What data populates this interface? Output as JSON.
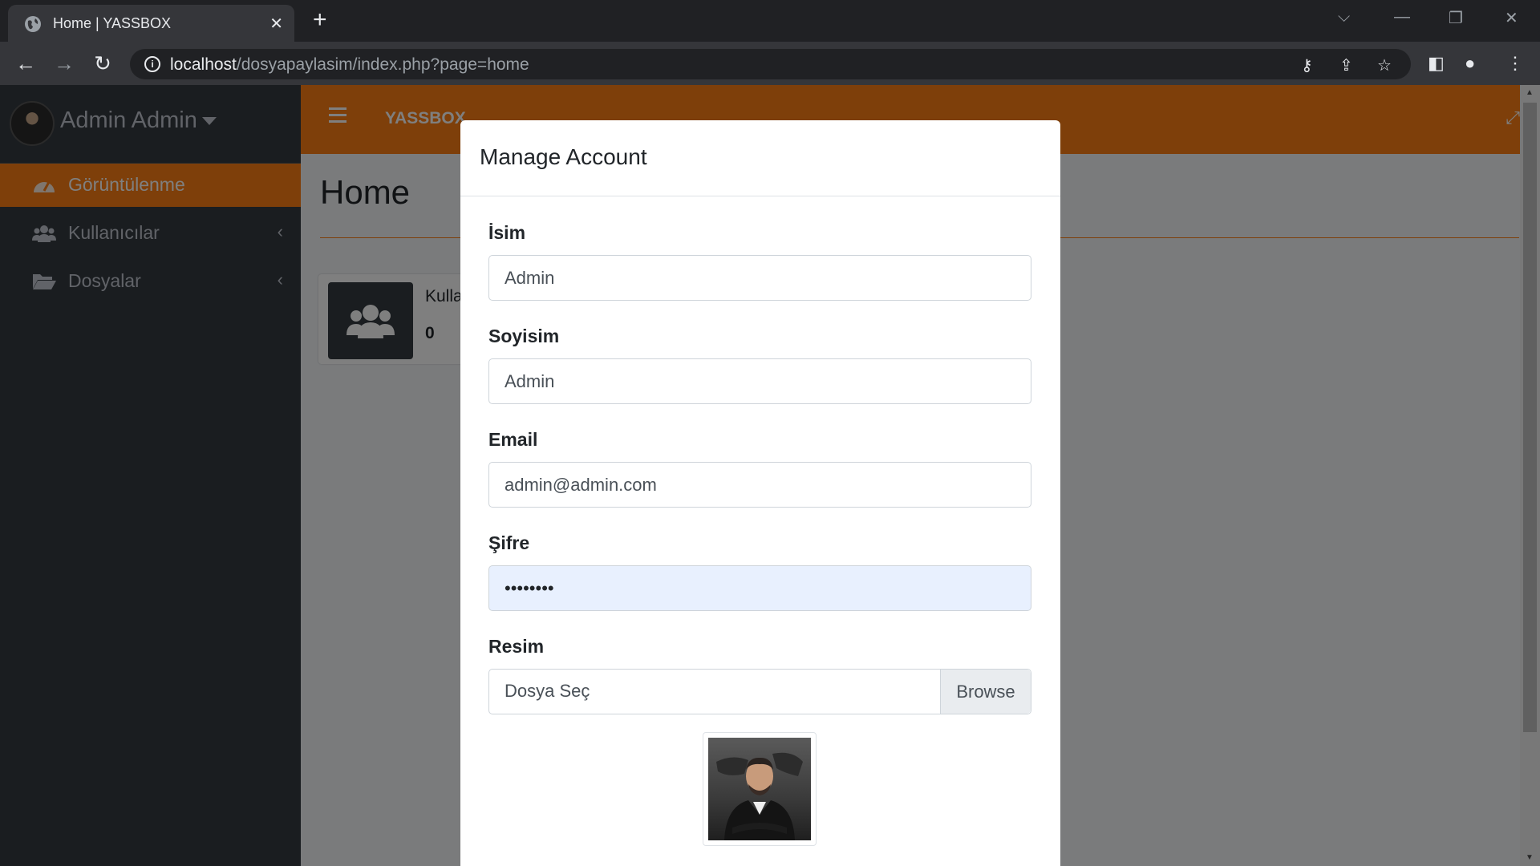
{
  "browser": {
    "tab_title": "Home | YASSBOX",
    "url_host": "localhost",
    "url_path": "/dosyapaylasim/index.php?page=home"
  },
  "sidebar": {
    "user_name": "Admin Admin",
    "items": [
      {
        "label": "Görüntülenme",
        "icon": "tachometer-icon",
        "active": true
      },
      {
        "label": "Kullanıcılar",
        "icon": "users-icon",
        "active": false
      },
      {
        "label": "Dosyalar",
        "icon": "folder-open-icon",
        "active": false
      }
    ]
  },
  "topnav": {
    "brand": "YASSBOX"
  },
  "content": {
    "page_title": "Home",
    "info_box": {
      "label": "Kulla",
      "value": "0"
    }
  },
  "modal": {
    "title": "Manage Account",
    "fields": {
      "first_name": {
        "label": "İsim",
        "value": "Admin"
      },
      "last_name": {
        "label": "Soyisim",
        "value": "Admin"
      },
      "email": {
        "label": "Email",
        "value": "admin@admin.com"
      },
      "password": {
        "label": "Şifre",
        "value": "••••••••"
      },
      "image": {
        "label": "Resim",
        "placeholder": "Dosya Seç",
        "button": "Browse"
      }
    }
  },
  "colors": {
    "accent": "#fd7e14",
    "sidebar_bg": "#343a40",
    "backdrop": "rgba(0,0,0,0.5)"
  }
}
